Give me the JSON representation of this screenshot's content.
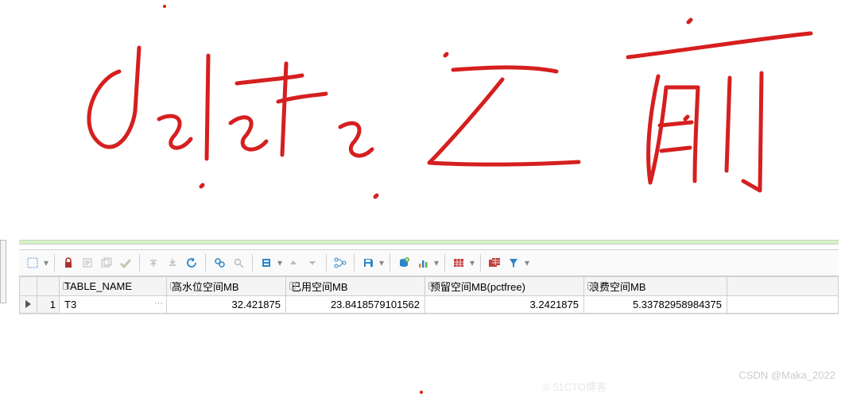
{
  "annotation_text": "delete 之前",
  "toolbar": {
    "icons": [
      {
        "name": "select-rect-icon",
        "color": "#6aa0d8"
      },
      {
        "name": "lock-icon",
        "color": "#b03030"
      },
      {
        "name": "fetch-page-icon",
        "color": "#999"
      },
      {
        "name": "fetch-all-icon",
        "color": "#999"
      },
      {
        "name": "commit-icon",
        "color": "#8fbf6a"
      },
      {
        "name": "collapse-up-icon",
        "color": "#999"
      },
      {
        "name": "collapse-down-icon",
        "color": "#999"
      },
      {
        "name": "refresh-icon",
        "color": "#2c85c9"
      },
      {
        "name": "find-icon",
        "color": "#2c85c9"
      },
      {
        "name": "find-next-icon",
        "color": "#999"
      },
      {
        "name": "single-record-icon",
        "color": "#2c85c9"
      },
      {
        "name": "nav-up-icon",
        "color": "#999"
      },
      {
        "name": "nav-down-icon",
        "color": "#999"
      },
      {
        "name": "link-query-icon",
        "color": "#2c85c9"
      },
      {
        "name": "save-icon",
        "color": "#2c85c9"
      },
      {
        "name": "export-db-icon",
        "color": "#2c85c9"
      },
      {
        "name": "chart-icon-orange",
        "color": "#e28a2b"
      },
      {
        "name": "grid-icon-red",
        "color": "#c04040"
      },
      {
        "name": "grid-stack-icon",
        "color": "#c04040"
      },
      {
        "name": "filter-funnel-icon",
        "color": "#2c85c9"
      }
    ]
  },
  "grid": {
    "columns": [
      "TABLE_NAME",
      "高水位空间MB",
      "已用空间MB",
      "预留空间MB(pctfree)",
      "浪费空间MB"
    ],
    "rows": [
      {
        "idx": "1",
        "TABLE_NAME": "T3",
        "高水位空间MB": "32.421875",
        "已用空间MB": "23.8418579101562",
        "预留空间MB(pctfree)": "3.2421875",
        "浪费空间MB": "5.33782958984375"
      }
    ]
  },
  "watermarks": {
    "w1": "CSDN @Maka_2022",
    "w2": "© 51CTO博客"
  }
}
